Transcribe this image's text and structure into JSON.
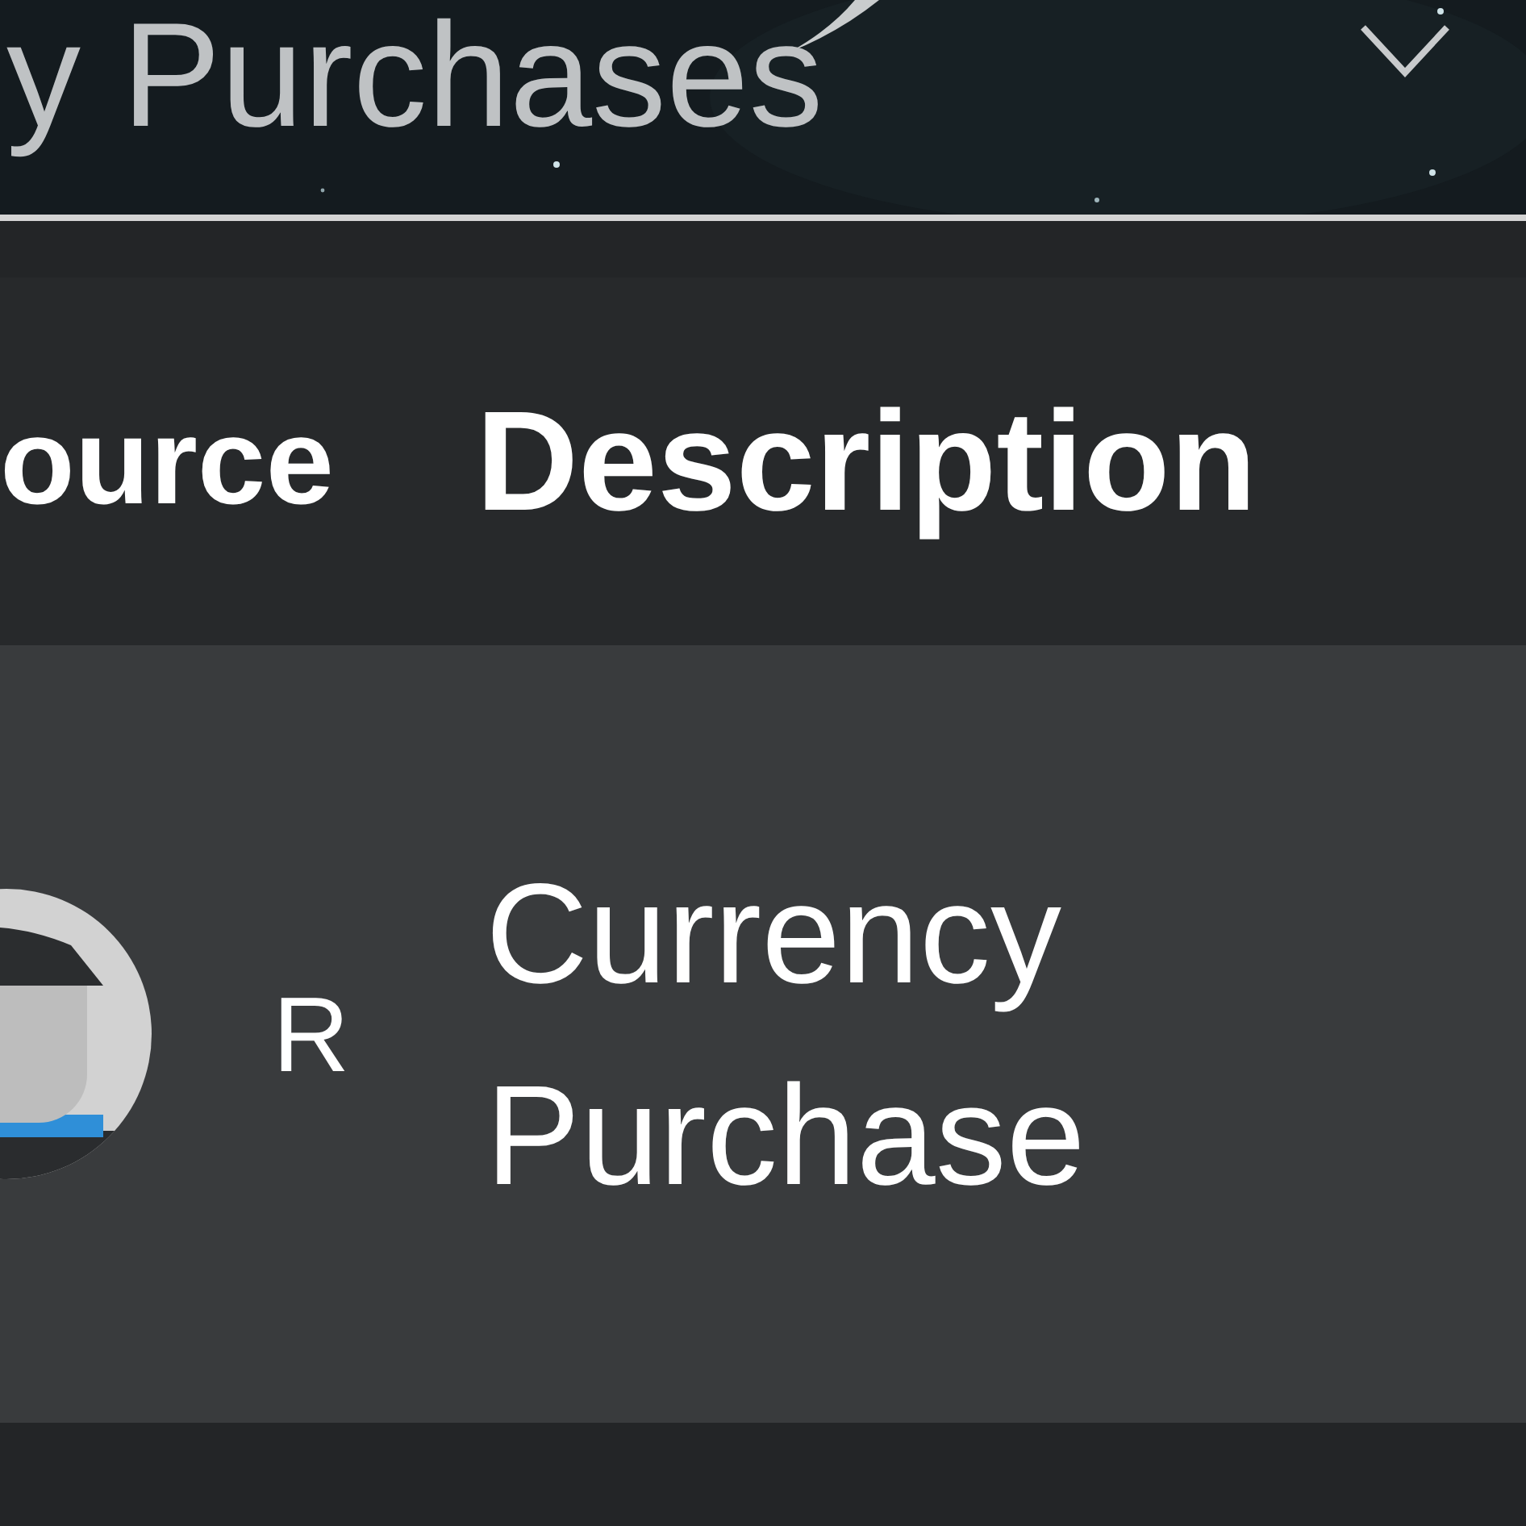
{
  "header": {
    "title": "y Purchases"
  },
  "table": {
    "columns": [
      "ource",
      "Description"
    ],
    "rows": [
      {
        "source": {
          "name": "R"
        },
        "description": "Currency Purchase"
      }
    ]
  }
}
